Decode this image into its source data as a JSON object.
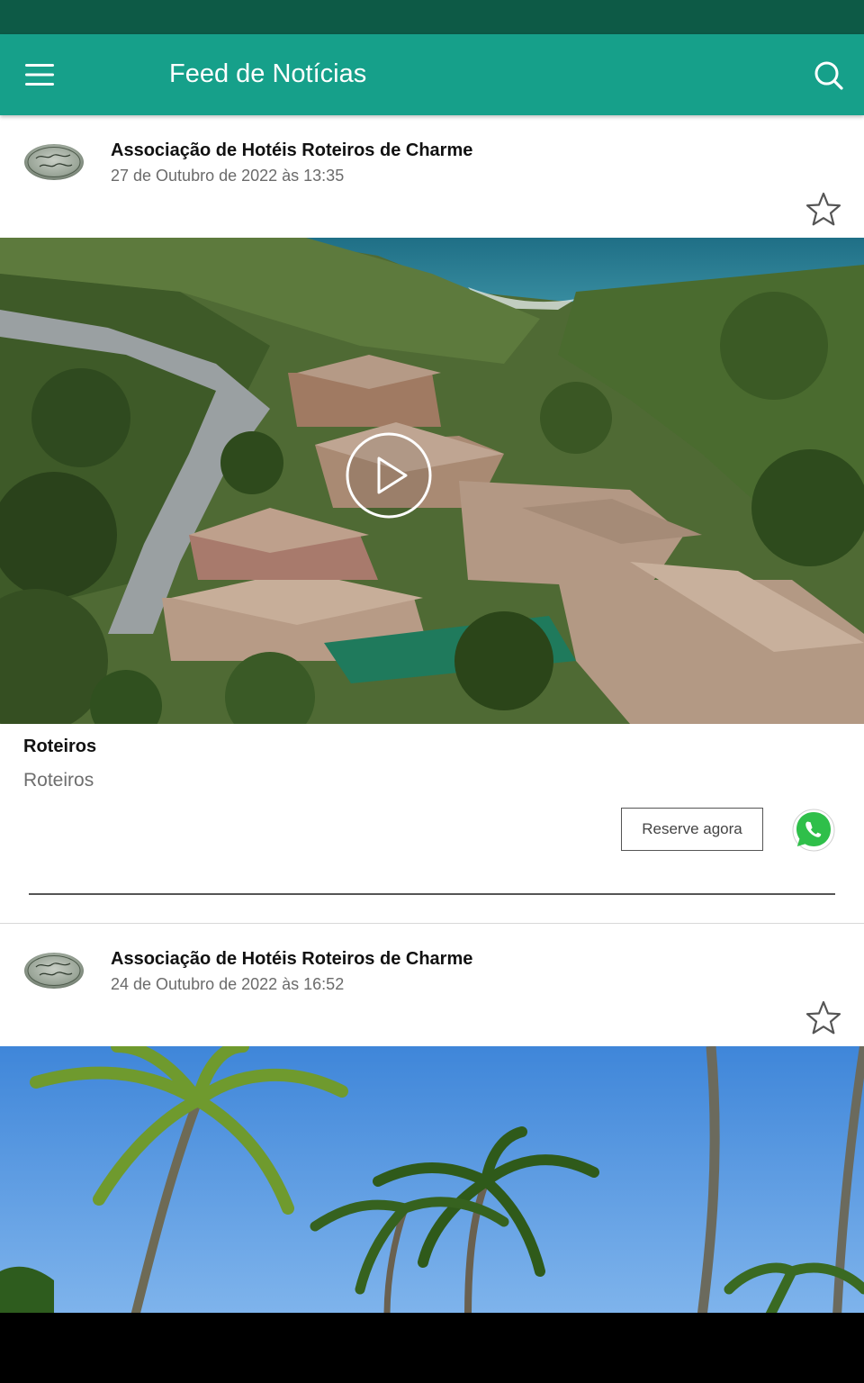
{
  "app_bar": {
    "title": "Feed de Notícias",
    "menu_icon": "hamburger-menu-icon",
    "search_icon": "search-icon",
    "background_color": "#16a08a",
    "status_bar_color": "#0d5a46"
  },
  "posts": [
    {
      "author": "Associação de Hotéis Roteiros de Charme",
      "timestamp": "27 de Outubro de 2022 às 13:35",
      "media_type": "video",
      "title": "Roteiros",
      "description": "Roteiros",
      "reserve_label": "Reserve agora",
      "favorite_icon": "star-outline-icon",
      "whatsapp_icon": "whatsapp-icon"
    },
    {
      "author": "Associação de Hotéis Roteiros de Charme",
      "timestamp": "24 de Outubro de 2022 às 16:52",
      "media_type": "image",
      "favorite_icon": "star-outline-icon"
    }
  ]
}
